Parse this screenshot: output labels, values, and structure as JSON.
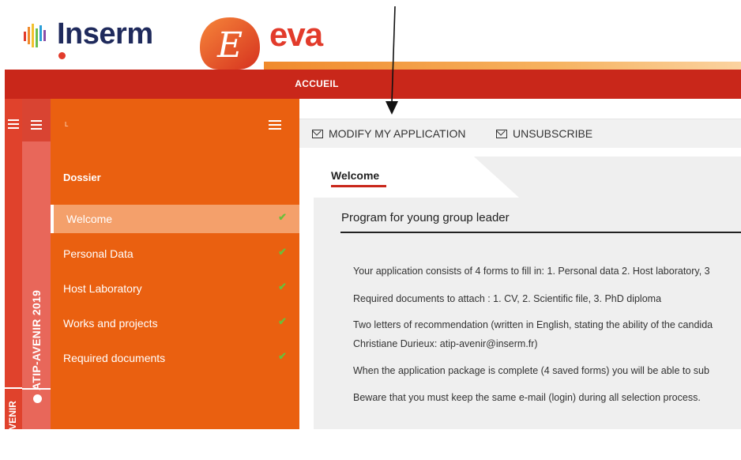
{
  "header": {
    "inserm_brand": "Inserm",
    "eva_brand": "eva",
    "eva_logo_letter": "E"
  },
  "topbar": {
    "label": "ACCUEIL"
  },
  "program_tabs": [
    {
      "label": "ATIP-AVENIR"
    },
    {
      "label": "ATIP-AVENIR 2019"
    }
  ],
  "sidebar": {
    "user_name": "L",
    "section_title": "Dossier",
    "items": [
      {
        "label": "Welcome",
        "active": true,
        "completed": true
      },
      {
        "label": "Personal Data",
        "active": false,
        "completed": true
      },
      {
        "label": "Host Laboratory",
        "active": false,
        "completed": true
      },
      {
        "label": "Works and projects",
        "active": false,
        "completed": true
      },
      {
        "label": "Required documents",
        "active": false,
        "completed": true
      }
    ],
    "check_glyph": "✔"
  },
  "toolbar": {
    "modify_label": "MODIFY MY APPLICATION",
    "unsubscribe_label": "UNSUBSCRIBE"
  },
  "content": {
    "tab_label": "Welcome",
    "program_title": "Program for young group leader",
    "paragraphs": [
      "Your application consists of 4 forms to fill in: 1. Personal data 2. Host laboratory, 3",
      "Required documents to attach : 1. CV, 2. Scientific file, 3. PhD diploma",
      "Two letters of recommendation (written in English, stating the ability of the candida",
      "Christiane Durieux: atip-avenir@inserm.fr)",
      "When the application package is complete (4 saved forms) you will be able to sub",
      "Beware that you must keep the same e-mail (login) during all selection process."
    ]
  },
  "colors": {
    "red": "#c9271a",
    "orange": "#ea6010",
    "active_item": "#f4a06b",
    "check_green": "#6abf3a",
    "navy": "#1f2a5c"
  }
}
